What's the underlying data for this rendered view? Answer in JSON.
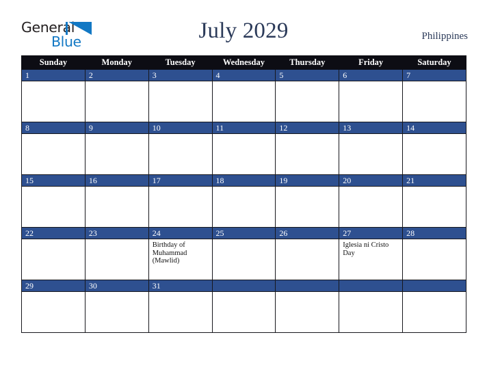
{
  "logo": {
    "text_primary": "General",
    "text_secondary": "Blue",
    "mark": "triangle-flag-icon",
    "primary_color": "#231f20",
    "accent_color": "#1278c4"
  },
  "header": {
    "title": "July 2029",
    "country": "Philippines",
    "title_color": "#2b3a59"
  },
  "calendar": {
    "weekday_headers": [
      "Sunday",
      "Monday",
      "Tuesday",
      "Wednesday",
      "Thursday",
      "Friday",
      "Saturday"
    ],
    "header_bg": "#0d0d14",
    "daynum_bg": "#2e5090",
    "weeks": [
      [
        {
          "day": "1",
          "events": []
        },
        {
          "day": "2",
          "events": []
        },
        {
          "day": "3",
          "events": []
        },
        {
          "day": "4",
          "events": []
        },
        {
          "day": "5",
          "events": []
        },
        {
          "day": "6",
          "events": []
        },
        {
          "day": "7",
          "events": []
        }
      ],
      [
        {
          "day": "8",
          "events": []
        },
        {
          "day": "9",
          "events": []
        },
        {
          "day": "10",
          "events": []
        },
        {
          "day": "11",
          "events": []
        },
        {
          "day": "12",
          "events": []
        },
        {
          "day": "13",
          "events": []
        },
        {
          "day": "14",
          "events": []
        }
      ],
      [
        {
          "day": "15",
          "events": []
        },
        {
          "day": "16",
          "events": []
        },
        {
          "day": "17",
          "events": []
        },
        {
          "day": "18",
          "events": []
        },
        {
          "day": "19",
          "events": []
        },
        {
          "day": "20",
          "events": []
        },
        {
          "day": "21",
          "events": []
        }
      ],
      [
        {
          "day": "22",
          "events": []
        },
        {
          "day": "23",
          "events": []
        },
        {
          "day": "24",
          "events": [
            "Birthday of Muhammad (Mawlid)"
          ]
        },
        {
          "day": "25",
          "events": []
        },
        {
          "day": "26",
          "events": []
        },
        {
          "day": "27",
          "events": [
            "Iglesia ni Cristo Day"
          ]
        },
        {
          "day": "28",
          "events": []
        }
      ],
      [
        {
          "day": "29",
          "events": []
        },
        {
          "day": "30",
          "events": []
        },
        {
          "day": "31",
          "events": []
        },
        {
          "day": "",
          "events": []
        },
        {
          "day": "",
          "events": []
        },
        {
          "day": "",
          "events": []
        },
        {
          "day": "",
          "events": []
        }
      ]
    ]
  }
}
